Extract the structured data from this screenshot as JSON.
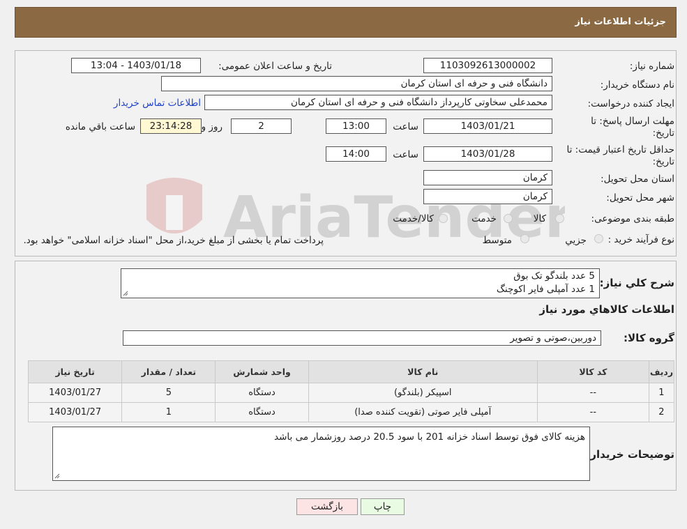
{
  "header": {
    "title": "جزئیات اطلاعات نیاز"
  },
  "form": {
    "need_number_label": "شماره نیاز:",
    "need_number": "1103092613000002",
    "announce_label": "تاریخ و ساعت اعلان عمومی:",
    "announce_value": "1403/01/18 - 13:04",
    "buyer_org_label": "نام دستگاه خریدار:",
    "buyer_org": "دانشگاه فنی و حرفه ای استان کرمان",
    "requester_label": "ایجاد کننده درخواست:",
    "requester": "محمدعلی سخاوتی کارپرداز دانشگاه فنی و حرفه ای استان کرمان",
    "contact_link": "اطلاعات تماس خریدار",
    "deadline_label_1": "مهلت ارسال پاسخ: تا",
    "deadline_label_2": "تاریخ:",
    "deadline_date": "1403/01/21",
    "time_word": "ساعت",
    "deadline_time": "13:00",
    "days_value": "2",
    "days_word": "روز و",
    "remaining_time": "23:14:28",
    "remaining_label": "ساعت باقي مانده",
    "validity_label_1": "حداقل تاریخ اعتبار قیمت: تا",
    "validity_label_2": "تاریخ:",
    "validity_date": "1403/01/28",
    "validity_time": "14:00",
    "province_label": "استان محل تحویل:",
    "province": "کرمان",
    "city_label": "شهر محل تحویل:",
    "city": "کرمان",
    "category_label": "طبقه بندی موضوعی:",
    "category_options": [
      "کالا",
      "خدمت",
      "کالا/خدمت"
    ],
    "purchase_type_label": "نوع فرآیند خرید :",
    "purchase_type_options": [
      "جزیي",
      "متوسط"
    ],
    "purchase_note": "پرداخت تمام یا بخشی از مبلغ خرید،از محل \"اسناد خزانه اسلامی\" خواهد بود."
  },
  "summary": {
    "label": "شرح کلي نياز:",
    "line1": "5 عدد بلندگو تک بوق",
    "line2": "1 عدد آمپلی فایر اکوچنگ"
  },
  "goods": {
    "section_title": "اطلاعات کالاهاي مورد نياز",
    "group_label": "گروه کالا:",
    "group_value": "دوربین،صوتی و تصویر",
    "columns": [
      "ردیف",
      "کد کالا",
      "نام کالا",
      "واحد شمارش",
      "تعداد / مقدار",
      "تاریخ نیاز"
    ],
    "rows": [
      [
        "1",
        "--",
        "اسپیکر (بلندگو)",
        "دستگاه",
        "5",
        "1403/01/27"
      ],
      [
        "2",
        "--",
        "آمپلی فایر صوتی (تقویت کننده صدا)",
        "دستگاه",
        "1",
        "1403/01/27"
      ]
    ]
  },
  "notes": {
    "label": "توضیحات خریدار:",
    "text": "هزینه کالای فوق توسط اسناد خزانه 201 با سود 20.5 درصد روزشمار می باشد"
  },
  "buttons": {
    "print": "چاپ",
    "back": "بازگشت"
  },
  "colors": {
    "header": "#8b6a43",
    "print_bg": "#e9fbe3",
    "back_bg": "#fde4e4"
  }
}
